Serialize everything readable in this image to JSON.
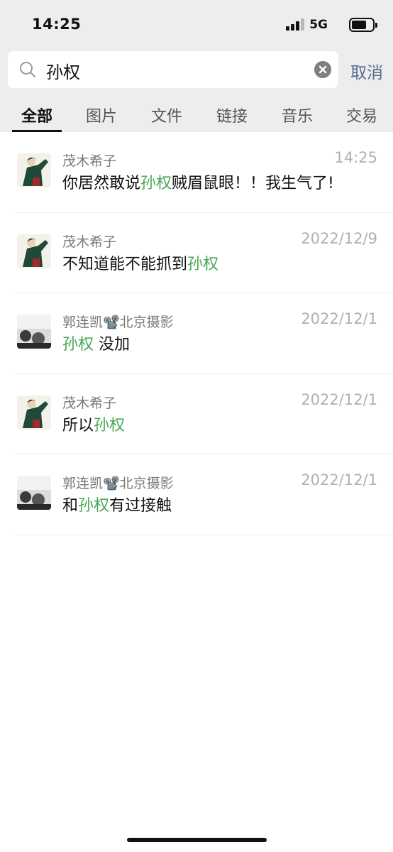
{
  "status_bar": {
    "time": "14:25",
    "network": "5G"
  },
  "search": {
    "query": "孙权",
    "cancel_label": "取消"
  },
  "tabs": [
    {
      "label": "全部"
    },
    {
      "label": "图片"
    },
    {
      "label": "文件"
    },
    {
      "label": "链接"
    },
    {
      "label": "音乐"
    },
    {
      "label": "交易"
    }
  ],
  "active_tab": "全部",
  "results": [
    {
      "sender": "茂木希子",
      "date": "14:25",
      "before": "你居然敢说",
      "highlight": "孙权",
      "after": "贼眉鼠眼！！我生气了!",
      "avatar": "anime-character-avatar"
    },
    {
      "sender": "茂木希子",
      "date": "2022/12/9",
      "before": "不知道能不能抓到",
      "highlight": "孙权",
      "after": "",
      "avatar": "anime-character-avatar"
    },
    {
      "sender": "郭连凯📽️北京摄影",
      "date": "2022/12/1",
      "before": "",
      "highlight": "孙权",
      "after": " 没加",
      "avatar": "bw-photo-avatar"
    },
    {
      "sender": "茂木希子",
      "date": "2022/12/1",
      "before": "所以",
      "highlight": "孙权",
      "after": "",
      "avatar": "anime-character-avatar"
    },
    {
      "sender": "郭连凯📽️北京摄影",
      "date": "2022/12/1",
      "before": "和",
      "highlight": "孙权",
      "after": "有过接触",
      "avatar": "bw-photo-avatar"
    }
  ],
  "colors": {
    "highlight": "#4aa856",
    "cancel_link": "#576b95",
    "header_bg": "#ededed",
    "date_text": "#b0b0b0"
  }
}
